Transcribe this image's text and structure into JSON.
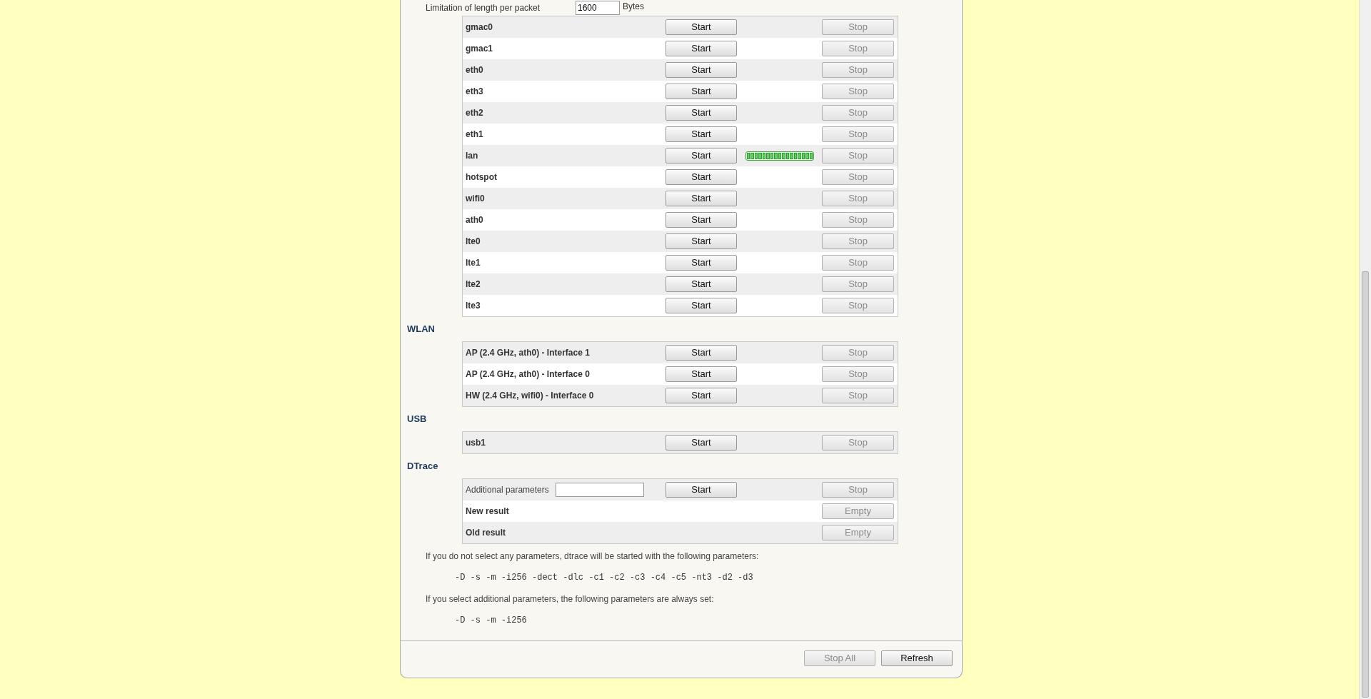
{
  "packet_limit": {
    "label": "Limitation of length per packet",
    "value": "1600",
    "unit": "Bytes"
  },
  "sections": [
    {
      "rows": [
        {
          "kind": "interface",
          "name": "gmac0",
          "start": "Start",
          "stop": "Stop",
          "stop_disabled": true,
          "capturing": false
        },
        {
          "kind": "interface",
          "name": "gmac1",
          "start": "Start",
          "stop": "Stop",
          "stop_disabled": true,
          "capturing": false
        },
        {
          "kind": "interface",
          "name": "eth0",
          "start": "Start",
          "stop": "Stop",
          "stop_disabled": true,
          "capturing": false
        },
        {
          "kind": "interface",
          "name": "eth3",
          "start": "Start",
          "stop": "Stop",
          "stop_disabled": true,
          "capturing": false
        },
        {
          "kind": "interface",
          "name": "eth2",
          "start": "Start",
          "stop": "Stop",
          "stop_disabled": true,
          "capturing": false
        },
        {
          "kind": "interface",
          "name": "eth1",
          "start": "Start",
          "stop": "Stop",
          "stop_disabled": true,
          "capturing": false
        },
        {
          "kind": "interface",
          "name": "lan",
          "start": "Start",
          "stop": "Stop",
          "stop_disabled": true,
          "capturing": true
        },
        {
          "kind": "interface",
          "name": "hotspot",
          "start": "Start",
          "stop": "Stop",
          "stop_disabled": true,
          "capturing": false
        },
        {
          "kind": "interface",
          "name": "wifi0",
          "start": "Start",
          "stop": "Stop",
          "stop_disabled": true,
          "capturing": false
        },
        {
          "kind": "interface",
          "name": "ath0",
          "start": "Start",
          "stop": "Stop",
          "stop_disabled": true,
          "capturing": false
        },
        {
          "kind": "interface",
          "name": "lte0",
          "start": "Start",
          "stop": "Stop",
          "stop_disabled": true,
          "capturing": false
        },
        {
          "kind": "interface",
          "name": "lte1",
          "start": "Start",
          "stop": "Stop",
          "stop_disabled": true,
          "capturing": false
        },
        {
          "kind": "interface",
          "name": "lte2",
          "start": "Start",
          "stop": "Stop",
          "stop_disabled": true,
          "capturing": false
        },
        {
          "kind": "interface",
          "name": "lte3",
          "start": "Start",
          "stop": "Stop",
          "stop_disabled": true,
          "capturing": false
        }
      ]
    },
    {
      "heading": "WLAN",
      "rows": [
        {
          "kind": "interface",
          "name": "AP (2.4 GHz, ath0) - Interface 1",
          "start": "Start",
          "stop": "Stop",
          "stop_disabled": true,
          "capturing": false
        },
        {
          "kind": "interface",
          "name": "AP (2.4 GHz, ath0) - Interface 0",
          "start": "Start",
          "stop": "Stop",
          "stop_disabled": true,
          "capturing": false
        },
        {
          "kind": "interface",
          "name": "HW (2.4 GHz, wifi0) - Interface 0",
          "start": "Start",
          "stop": "Stop",
          "stop_disabled": true,
          "capturing": false
        }
      ]
    },
    {
      "heading": "USB",
      "rows": [
        {
          "kind": "interface",
          "name": "usb1",
          "start": "Start",
          "stop": "Stop",
          "stop_disabled": true,
          "capturing": false
        }
      ]
    },
    {
      "heading": "DTrace",
      "rows": [
        {
          "kind": "params",
          "name": "Additional parameters",
          "start": "Start",
          "stop": "Stop",
          "stop_disabled": true
        },
        {
          "kind": "result",
          "name": "New result",
          "stop": "Empty",
          "stop_disabled": true
        },
        {
          "kind": "result",
          "name": "Old result",
          "stop": "Empty",
          "stop_disabled": true
        }
      ]
    }
  ],
  "notes": [
    {
      "kind": "text",
      "text": "If you do not select any parameters, dtrace will be started with the following parameters:"
    },
    {
      "kind": "code",
      "text": "-D -s -m -i256 -dect -dlc -c1 -c2 -c3 -c4 -c5 -nt3 -d2 -d3"
    },
    {
      "kind": "text",
      "text": "If you select additional parameters, the following parameters are always set:"
    },
    {
      "kind": "code",
      "text": "-D -s -m -i256"
    }
  ],
  "footer": [
    {
      "label": "Stop All",
      "disabled": true
    },
    {
      "label": "Refresh",
      "disabled": false
    }
  ]
}
